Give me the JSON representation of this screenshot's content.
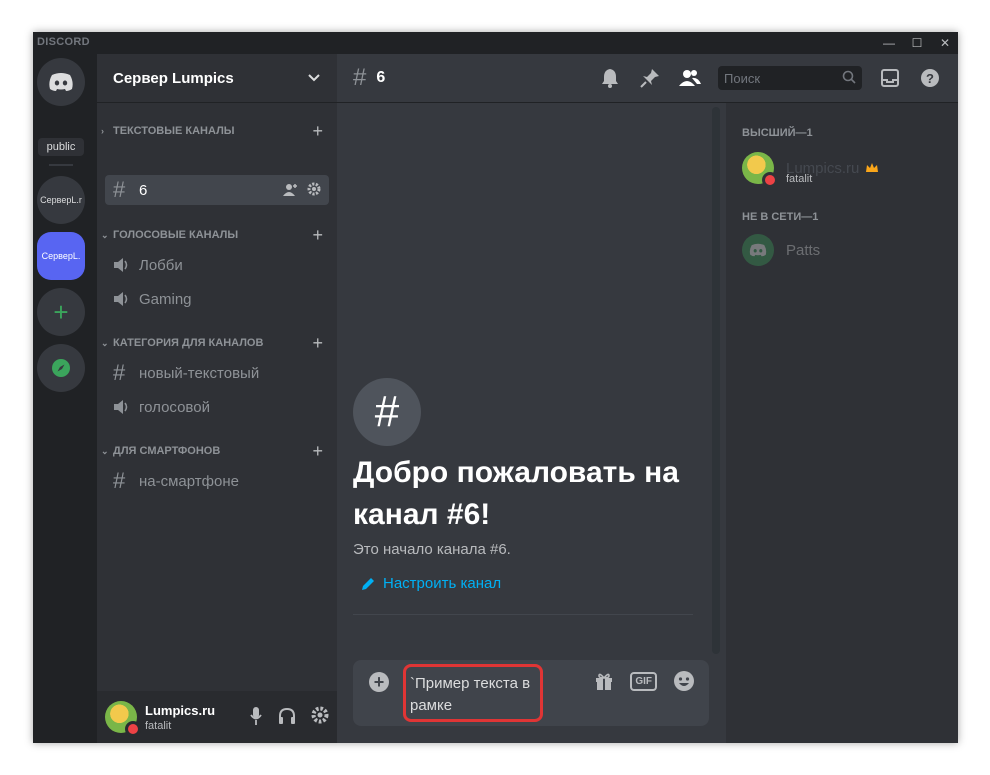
{
  "app": {
    "logo": "DISCORD"
  },
  "window_controls": {
    "min": "—",
    "max": "☐",
    "close": "✕"
  },
  "guilds": {
    "public_label": "public",
    "items": [
      "СерверL.r",
      "СерверL."
    ]
  },
  "server": {
    "name": "Сервер Lumpics",
    "categories": [
      {
        "name": "ТЕКСТОВЫЕ КАНАЛЫ",
        "channels": [
          {
            "name": "6",
            "type": "text",
            "selected": true
          }
        ]
      },
      {
        "name": "ГОЛОСОВЫЕ КАНАЛЫ",
        "channels": [
          {
            "name": "Лобби",
            "type": "voice"
          },
          {
            "name": "Gaming",
            "type": "voice"
          }
        ]
      },
      {
        "name": "КАТЕГОРИЯ ДЛЯ КАНАЛОВ",
        "channels": [
          {
            "name": "новый-текстовый",
            "type": "text"
          },
          {
            "name": "голосовой",
            "type": "voice"
          }
        ]
      },
      {
        "name": "ДЛЯ СМАРТФОНОВ",
        "channels": [
          {
            "name": "на-смартфоне",
            "type": "text"
          }
        ]
      }
    ]
  },
  "user_panel": {
    "name": "Lumpics.ru",
    "tag": "fatalit"
  },
  "channel_header": {
    "name": "6",
    "search_placeholder": "Поиск"
  },
  "welcome": {
    "title": "Добро пожаловать на канал #6!",
    "description": "Это начало канала #6.",
    "setup_link": "Настроить канал"
  },
  "composer": {
    "text_line1": "`Пример текста в",
    "text_line2": "рамке",
    "gif_label": "GIF"
  },
  "members": {
    "groups": [
      {
        "label": "ВЫСШИЙ—1",
        "members": [
          {
            "name": "Lumpics.ru",
            "status_text": "fatalit",
            "owner": true
          }
        ]
      },
      {
        "label": "НЕ В СЕТИ—1",
        "members": [
          {
            "name": "Patts"
          }
        ]
      }
    ]
  },
  "colors": {
    "blurple": "#5865f2",
    "green": "#3ba55c",
    "dnd": "#ed4245",
    "link": "#00b0f4",
    "highlight": "#e03535"
  }
}
